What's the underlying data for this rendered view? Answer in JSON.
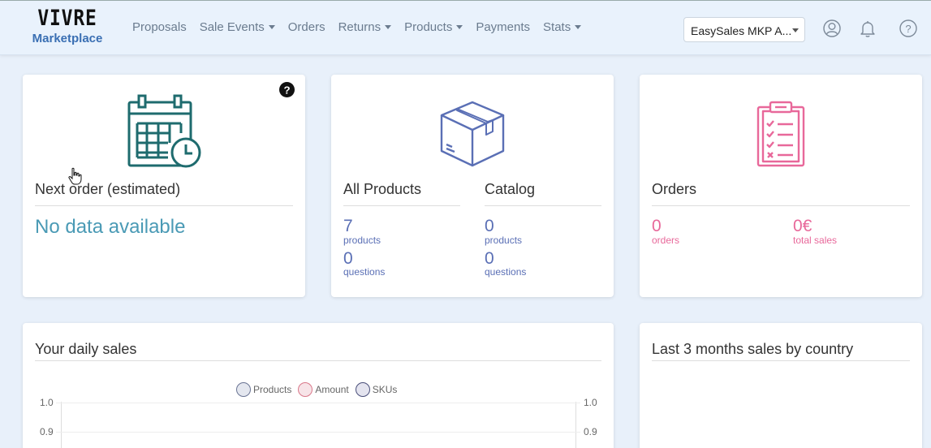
{
  "brand": {
    "logo": "VIVRE",
    "subtitle": "Marketplace"
  },
  "nav": [
    {
      "label": "Proposals",
      "dropdown": false
    },
    {
      "label": "Sale Events",
      "dropdown": true
    },
    {
      "label": "Orders",
      "dropdown": false
    },
    {
      "label": "Returns",
      "dropdown": true
    },
    {
      "label": "Products",
      "dropdown": true
    },
    {
      "label": "Payments",
      "dropdown": false
    },
    {
      "label": "Stats",
      "dropdown": true
    }
  ],
  "store_select": {
    "value": "EasySales MKP A..."
  },
  "icons": {
    "user": "user-circle-icon",
    "bell": "bell-icon",
    "help": "question-circle-icon"
  },
  "next_order": {
    "title": "Next order (estimated)",
    "value": "No data available"
  },
  "all_products": {
    "title": "All Products",
    "products_count": "7",
    "products_label": "products",
    "questions_count": "0",
    "questions_label": "questions"
  },
  "catalog": {
    "title": "Catalog",
    "products_count": "0",
    "products_label": "products",
    "questions_count": "0",
    "questions_label": "questions"
  },
  "orders": {
    "title": "Orders",
    "orders_count": "0",
    "orders_label": "orders",
    "sales_value": "0€",
    "sales_label": "total sales"
  },
  "daily_sales": {
    "title": "Your daily sales"
  },
  "country_sales": {
    "title": "Last 3 months sales by country"
  },
  "colors": {
    "teal": "#1e6b6e",
    "blue": "#5a6fb5",
    "pink": "#e8689a",
    "nodata": "#4a9ab5"
  },
  "chart_data": {
    "type": "line",
    "series": [
      {
        "name": "Products",
        "values": []
      },
      {
        "name": "Amount",
        "values": []
      },
      {
        "name": "SKUs",
        "values": []
      }
    ],
    "y_ticks_left": [
      "1.0",
      "0.9"
    ],
    "y_ticks_right": [
      "1.0",
      "0.9"
    ],
    "legend_position": "top-center"
  }
}
